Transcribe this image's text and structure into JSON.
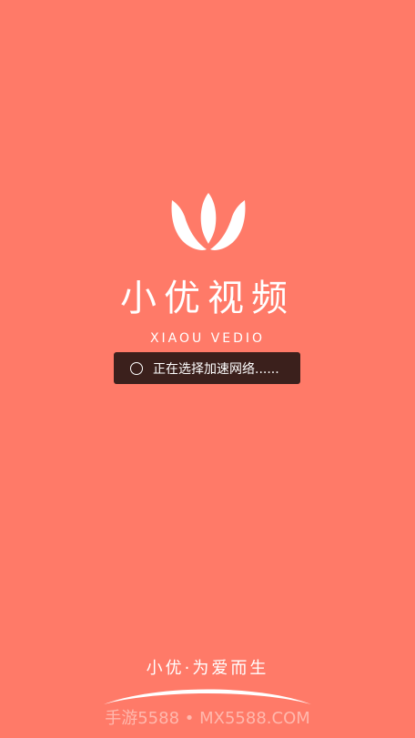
{
  "splash": {
    "app_name": "小优视频",
    "app_name_en": "XIAOU VEDIO",
    "slogan": "小优·为爱而生",
    "logo_icon": "lotus-logo-icon",
    "background_color": "#FF7A68"
  },
  "toast": {
    "message": "正在选择加速网络......",
    "spinner_icon": "loading-spinner-icon",
    "background_color": "#3B201C"
  },
  "watermark": {
    "text": "手游5588 • MX5588.COM"
  }
}
